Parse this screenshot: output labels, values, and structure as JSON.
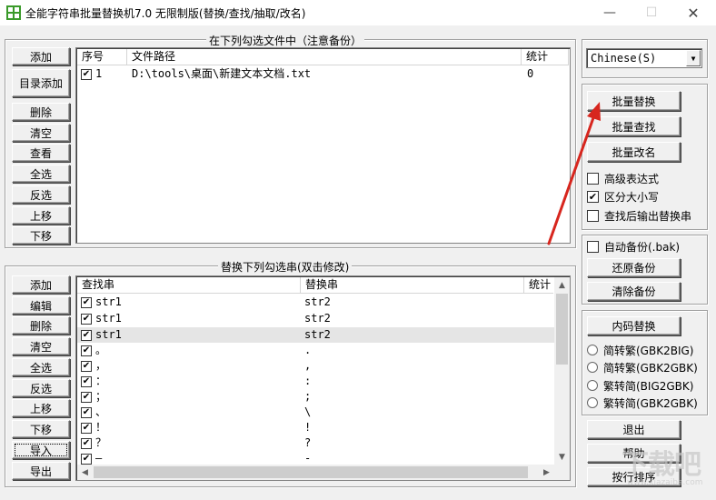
{
  "window": {
    "title": "全能字符串批量替换机7.0 无限制版(替换/查找/抽取/改名)",
    "minimize": "—",
    "maximize": "☐",
    "close": "✕"
  },
  "files": {
    "legend": "在下列勾选文件中（注意备份）",
    "buttons": [
      "添加",
      "目录添加",
      "删除",
      "清空",
      "查看",
      "全选",
      "反选",
      "上移",
      "下移"
    ],
    "columns": [
      "序号",
      "文件路径",
      "统计"
    ],
    "rows": [
      {
        "index": "1",
        "path": "D:\\tools\\桌面\\新建文本文档.txt",
        "count": "0",
        "checked": true
      }
    ]
  },
  "replace": {
    "legend": "替换下列勾选串(双击修改)",
    "buttons": [
      "添加",
      "编辑",
      "删除",
      "清空",
      "全选",
      "反选",
      "上移",
      "下移",
      "导入",
      "导出"
    ],
    "columns": [
      "查找串",
      "替换串",
      "统计"
    ],
    "rows": [
      {
        "find": "str1",
        "repl": "str2"
      },
      {
        "find": "str1",
        "repl": "str2"
      },
      {
        "find": "str1",
        "repl": "str2"
      },
      {
        "find": "。",
        "repl": "."
      },
      {
        "find": "，",
        "repl": ","
      },
      {
        "find": "：",
        "repl": ":"
      },
      {
        "find": "；",
        "repl": ";"
      },
      {
        "find": "、",
        "repl": "\\"
      },
      {
        "find": "！",
        "repl": "!"
      },
      {
        "find": "？",
        "repl": "?"
      },
      {
        "find": "—",
        "repl": "-"
      }
    ]
  },
  "right": {
    "language": "Chinese(S)",
    "batch_replace": "批量替换",
    "batch_find": "批量查找",
    "batch_rename": "批量改名",
    "regex": "高级表达式",
    "match_case": "区分大小写",
    "output_after_find": "查找后输出替换串",
    "auto_backup": "自动备份(.bak)",
    "restore_backup": "还原备份",
    "clear_backup": "清除备份",
    "code_replace": "内码替换",
    "radio_options": [
      "简转繁(GBK2BIG)",
      "简转繁(GBK2GBK)",
      "繁转简(BIG2GBK)",
      "繁转简(GBK2GBK)"
    ],
    "exit": "退出",
    "help": "帮助",
    "sort_lines": "按行排序"
  },
  "watermark": {
    "text": "下载吧",
    "url": "www.xiazaiba.com"
  },
  "colors": {
    "arrow": "#d7261e",
    "window_bg": "#f0f0f0",
    "row_highlight": "#e5e5e5"
  }
}
